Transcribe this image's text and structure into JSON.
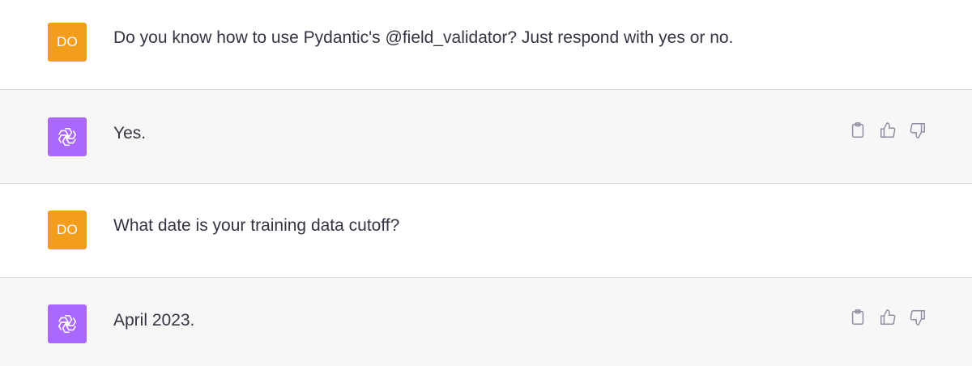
{
  "conversation": {
    "messages": [
      {
        "role": "user",
        "avatar_text": "DO",
        "text": "Do you know how to use Pydantic's @field_validator? Just respond with yes or no."
      },
      {
        "role": "assistant",
        "avatar_icon": "openai-logo-icon",
        "text": "Yes.",
        "actions": [
          "copy-icon",
          "thumbs-up-icon",
          "thumbs-down-icon"
        ]
      },
      {
        "role": "user",
        "avatar_text": "DO",
        "text": "What date is your training data cutoff?"
      },
      {
        "role": "assistant",
        "avatar_icon": "openai-logo-icon",
        "text": "April 2023.",
        "actions": [
          "copy-icon",
          "thumbs-up-icon",
          "thumbs-down-icon"
        ]
      }
    ]
  },
  "colors": {
    "user_avatar": "#f29e1c",
    "assistant_avatar": "#ab68ff",
    "assistant_row_bg": "#f7f7f8",
    "text": "#343541",
    "icon": "#8e8ea0"
  }
}
